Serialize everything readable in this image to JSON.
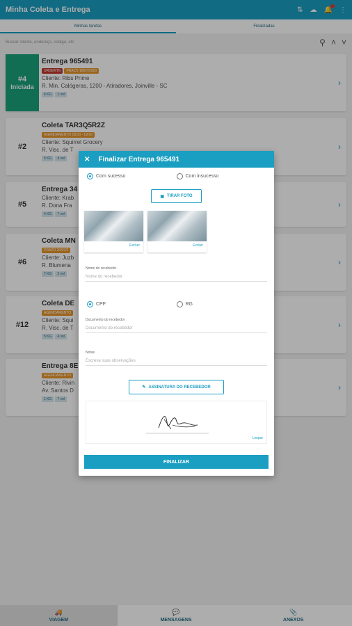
{
  "app": {
    "title": "Minha Coleta e Entrega"
  },
  "tabs": [
    {
      "label": "Minhas tarefas"
    },
    {
      "label": "Finalizadas"
    }
  ],
  "search": {
    "placeholder": "Buscar cliente, endereço, código, etc"
  },
  "cards": [
    {
      "num": "#4",
      "status": "Iniciada",
      "title": "Entrega 965491",
      "badges": [
        "URGENTE",
        "PRAZO 18/07/2023"
      ],
      "client": "Cliente: Ribs Prime",
      "address": "R. Min. Calógeras, 1200 - Atiradores, Joinville - SC",
      "tags": [
        "4 KG",
        "1 vol"
      ]
    },
    {
      "num": "#2",
      "title": "Coleta TAR3Q5R2Z",
      "badges": [
        "AGENDAMENTO 18:00 - 19:00"
      ],
      "client": "Cliente: Squirrel Grocery",
      "address": "R. Visc. de T",
      "tags": [
        "5 KG",
        "4 vol"
      ]
    },
    {
      "num": "#5",
      "title": "Entrega 34",
      "client": "Cliente: Krab",
      "address": "R. Dona Fra",
      "tags": [
        "4 KG",
        "7 vol"
      ]
    },
    {
      "num": "#6",
      "title": "Coleta MN",
      "badges": [
        "PRAZO 20/07/2"
      ],
      "client": "Cliente: Juzb",
      "address": "R. Blumena",
      "tags": [
        "7 KG",
        "2 vol"
      ]
    },
    {
      "num": "#12",
      "title": "Coleta DE",
      "badges": [
        "AGENDAMENTO"
      ],
      "client": "Cliente: Squi",
      "address": "R. Visc. de T",
      "tags": [
        "5 KG",
        "4 vol"
      ]
    },
    {
      "num": "",
      "title": "Entrega 8E",
      "badges": [
        "AGENDAMENTO"
      ],
      "client": "Cliente: Rivin",
      "address": "Av. Santos D",
      "tags": [
        "1 KG",
        "7 vol"
      ]
    }
  ],
  "modal": {
    "title": "Finalizar Entrega 965491",
    "success_label": "Com sucesso",
    "failure_label": "Com insucesso",
    "photo_button": "TIRAR FOTO",
    "delete_label": "Excluir",
    "receiver_label": "Nome do recebedor",
    "receiver_placeholder": "Nome do recebedor",
    "cpf_label": "CPF",
    "rg_label": "RG",
    "doc_label": "Documento do recebedor",
    "doc_placeholder": "Documento do recebedor",
    "notes_label": "Notas",
    "notes_placeholder": "Escreva suas observações",
    "signature_button": "ASSINATURA DO RECEBEDOR",
    "clear_label": "Limpar",
    "finish_button": "FINALIZAR"
  },
  "bottom_nav": [
    {
      "label": "VIAGEM"
    },
    {
      "label": "MENSAGENS"
    },
    {
      "label": "ANEXOS"
    }
  ],
  "colors": {
    "primary": "#1a9ec1",
    "started": "#1aa37a",
    "urgent": "#c0392b",
    "deadline": "#e6962a"
  }
}
